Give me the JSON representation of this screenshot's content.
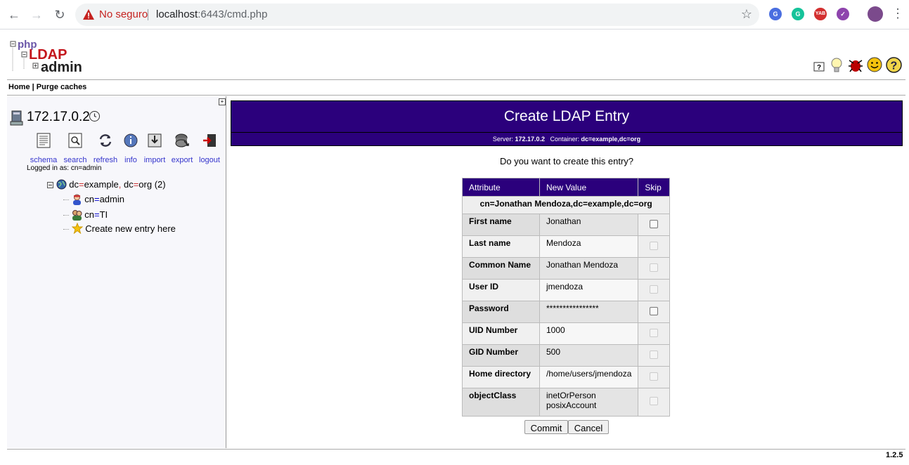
{
  "browser": {
    "security_text": "No seguro",
    "url_host": "localhost",
    "url_rest": ":6443/cmd.php",
    "extensions": [
      {
        "name": "translate-extension-icon",
        "color": "#4a6ee0",
        "text": "G"
      },
      {
        "name": "grammarly-extension-icon",
        "color": "#15c39a",
        "text": "G"
      },
      {
        "name": "yab-extension-icon",
        "color": "#d32f2f",
        "text": "YAB"
      },
      {
        "name": "check-extension-icon",
        "color": "#8e44ad",
        "text": "✓"
      }
    ]
  },
  "header": {
    "home_link": "Home",
    "separator": "|",
    "purge_link": "Purge caches"
  },
  "sidebar": {
    "server_name": "172.17.0.2",
    "tools": [
      "schema",
      "search",
      "refresh",
      "info",
      "import",
      "export",
      "logout"
    ],
    "logged_in": "Logged in as: cn=admin",
    "tree": {
      "root": {
        "k1": "dc",
        "v1": "example",
        "k2": "dc",
        "v2": "org",
        "count": "(2)"
      },
      "items": [
        {
          "k": "cn",
          "v": "admin"
        },
        {
          "k": "cn",
          "v": "TI"
        }
      ],
      "create": "Create new entry here"
    }
  },
  "main": {
    "title": "Create LDAP Entry",
    "server_label": "Server:",
    "server_value": "172.17.0.2",
    "container_label": "Container:",
    "container_value": "dc=example,dc=org",
    "question": "Do you want to create this entry?",
    "table": {
      "headers": [
        "Attribute",
        "New Value",
        "Skip"
      ],
      "dn": "cn=Jonathan Mendoza,dc=example,dc=org",
      "rows": [
        {
          "attr": "First name",
          "value": "Jonathan",
          "skip_enabled": true
        },
        {
          "attr": "Last name",
          "value": "Mendoza",
          "skip_enabled": false
        },
        {
          "attr": "Common Name",
          "value": "Jonathan Mendoza",
          "skip_enabled": false
        },
        {
          "attr": "User ID",
          "value": "jmendoza",
          "skip_enabled": false
        },
        {
          "attr": "Password",
          "value": "****************",
          "skip_enabled": true
        },
        {
          "attr": "UID Number",
          "value": "1000",
          "skip_enabled": false
        },
        {
          "attr": "GID Number",
          "value": "500",
          "skip_enabled": false
        },
        {
          "attr": "Home directory",
          "value": "/home/users/jmendoza",
          "skip_enabled": false
        },
        {
          "attr": "objectClass",
          "value": "inetOrPerson",
          "value2": "posixAccount",
          "skip_enabled": false
        }
      ]
    },
    "commit_label": "Commit",
    "cancel_label": "Cancel"
  },
  "footer": {
    "version": "1.2.5"
  },
  "colors": {
    "accent": "#2b007c"
  }
}
